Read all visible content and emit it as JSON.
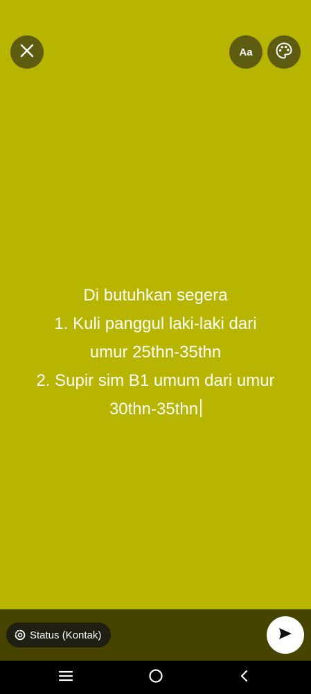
{
  "toolbar": {
    "close_icon": "close-icon",
    "font_label": "Aa",
    "palette_icon": "palette-icon"
  },
  "status": {
    "lines": [
      "Di butuhkan segera",
      "1. Kuli panggul laki-laki dari",
      "umur 25thn-35thn",
      "2. Supir sim B1 umum dari umur",
      "30thn-35thn"
    ],
    "background_color": "#b8b500"
  },
  "footer": {
    "audience_label": "Status (Kontak)",
    "audience_icon": "status-icon",
    "send_icon": "send-icon"
  },
  "nav": {
    "recents_icon": "recents-icon",
    "home_icon": "home-icon",
    "back_icon": "back-icon"
  }
}
